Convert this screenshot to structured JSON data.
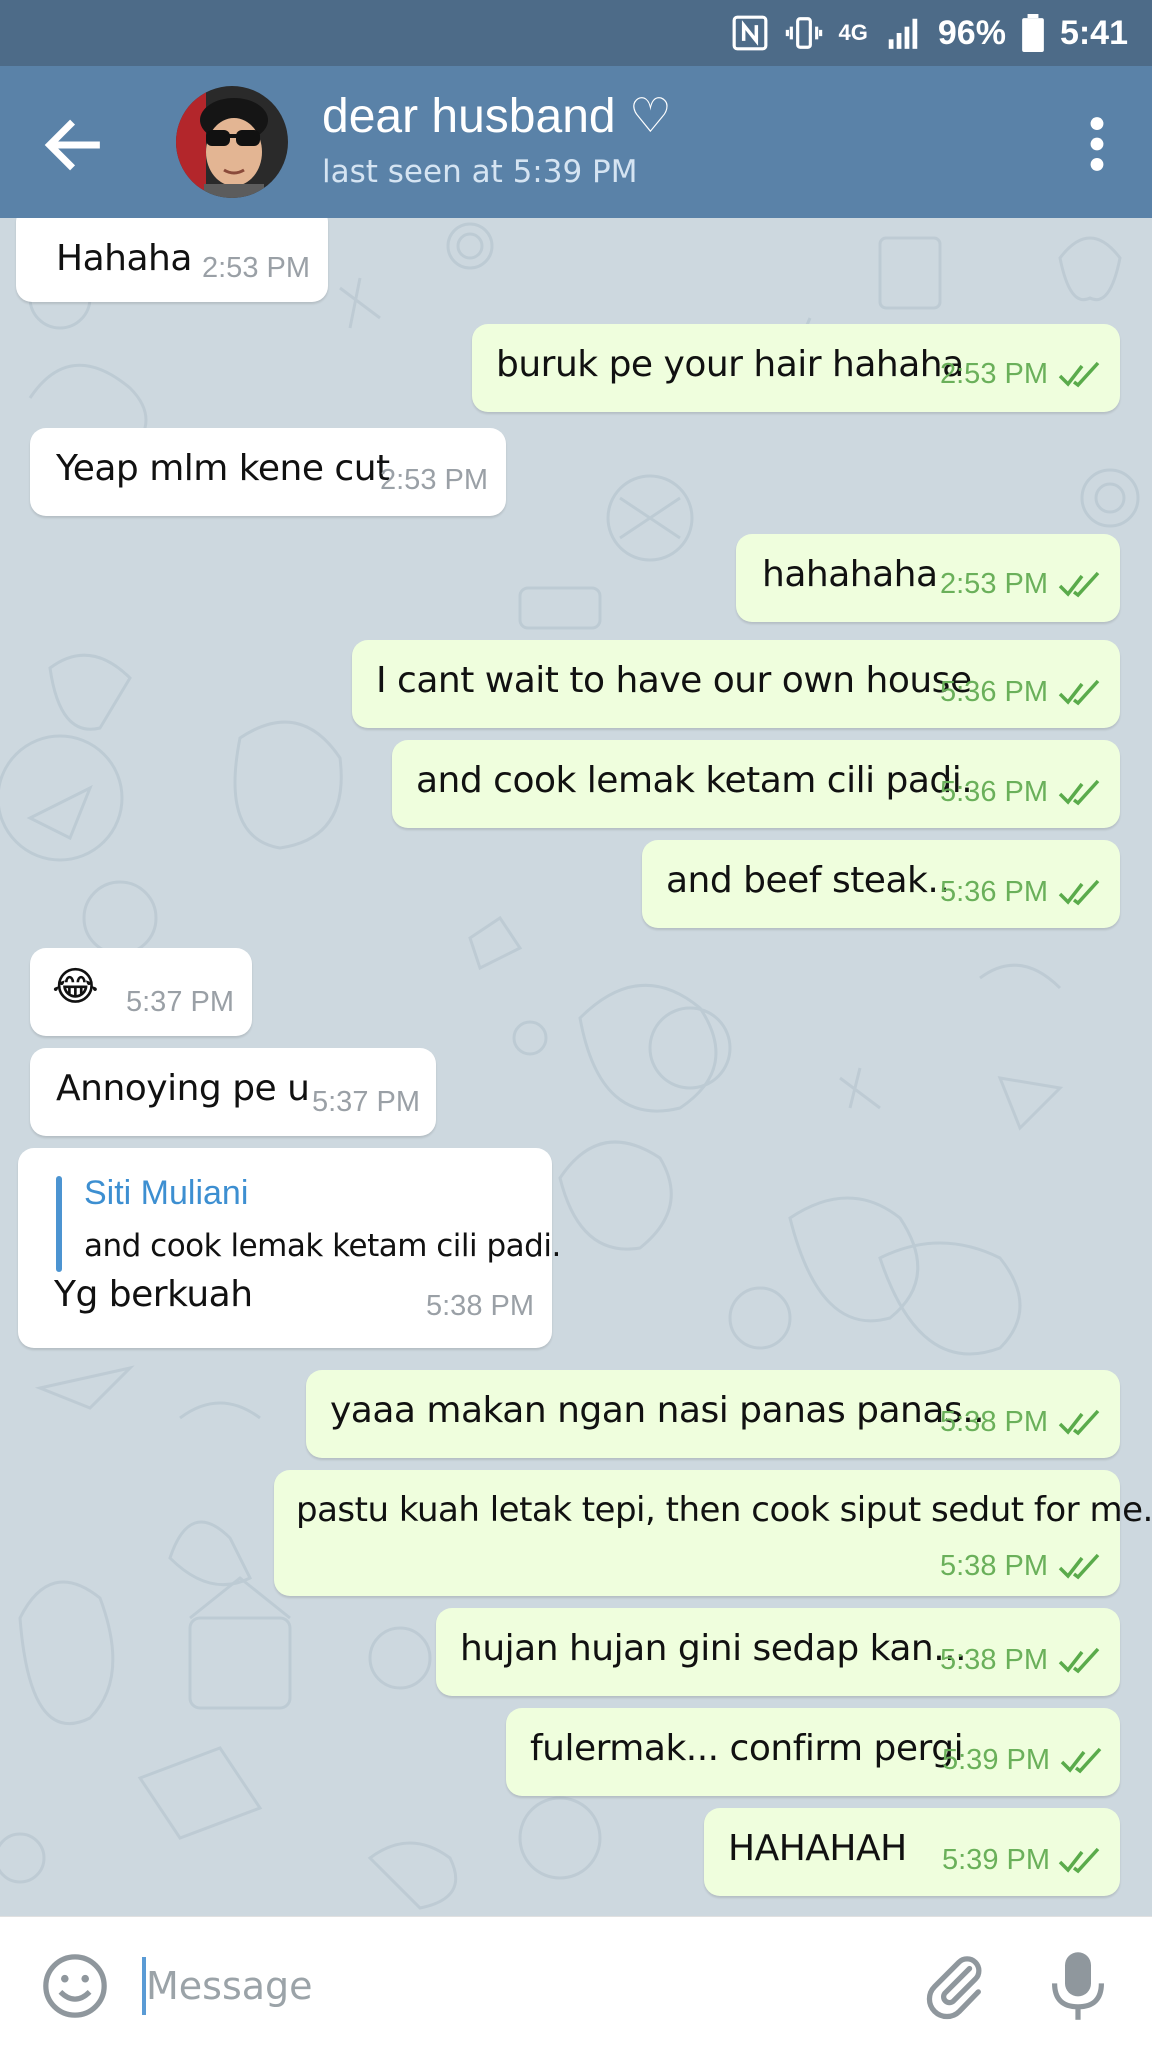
{
  "status_bar": {
    "battery": "96%",
    "time": "5:41",
    "network": "4G"
  },
  "header": {
    "title": "dear husband ♡",
    "subtitle": "last seen at 5:39 PM"
  },
  "messages": [
    {
      "dir": "in",
      "text": "Hahaha",
      "time": "2:53 PM"
    },
    {
      "dir": "out",
      "text": "buruk pe your hair hahaha",
      "time": "2:53 PM"
    },
    {
      "dir": "in",
      "text": "Yeap mlm kene cut",
      "time": "2:53 PM"
    },
    {
      "dir": "out",
      "text": "hahahaha",
      "time": "2:53 PM"
    },
    {
      "dir": "out",
      "text": "I cant wait to have our own house",
      "time": "5:36 PM"
    },
    {
      "dir": "out",
      "text": "and cook lemak ketam cili padi.",
      "time": "5:36 PM"
    },
    {
      "dir": "out",
      "text": "and beef steak..",
      "time": "5:36 PM"
    },
    {
      "dir": "in",
      "text": "😂",
      "time": "5:37 PM"
    },
    {
      "dir": "in",
      "text": "Annoying pe u",
      "time": "5:37 PM"
    },
    {
      "dir": "in",
      "reply_name": "Siti Muliani",
      "reply_text": "and cook lemak ketam cili padi.",
      "text": "Yg berkuah",
      "time": "5:38 PM"
    },
    {
      "dir": "out",
      "text": "yaaa makan ngan nasi panas panas..",
      "time": "5:38 PM"
    },
    {
      "dir": "out",
      "text": "pastu kuah letak tepi, then cook siput sedut for me.",
      "time": "5:38 PM"
    },
    {
      "dir": "out",
      "text": "hujan hujan gini sedap kan...",
      "time": "5:38 PM"
    },
    {
      "dir": "out",
      "text": "fulermak... confirm pergi",
      "time": "5:39 PM"
    },
    {
      "dir": "out",
      "text": "HAHAHAH",
      "time": "5:39 PM"
    }
  ],
  "input": {
    "placeholder": "Message"
  },
  "colors": {
    "header": "#5a82a8",
    "status_bar": "#4d6b88",
    "outgoing_bubble": "#effedd",
    "incoming_bubble": "#ffffff",
    "time_out": "#6ab05a",
    "reply_accent": "#3d8fd1"
  },
  "icons": {
    "back": "arrow-left-icon",
    "menu": "more-vertical-icon",
    "emoji": "smile-icon",
    "attach": "paperclip-icon",
    "mic": "microphone-icon",
    "read": "double-check-icon"
  }
}
